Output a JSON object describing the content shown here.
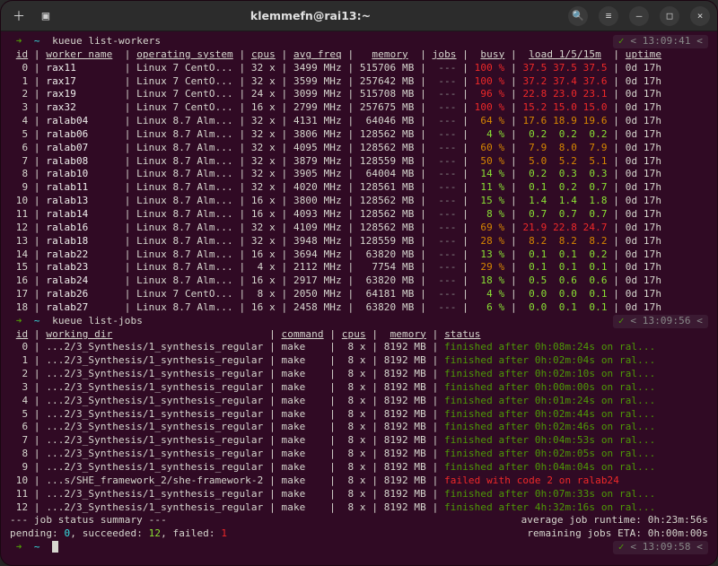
{
  "window": {
    "title": "klemmefn@rai13:~"
  },
  "prompt1": {
    "arrow": "➜",
    "path": "~",
    "cmd": "kueue list-workers",
    "time": "13:09:41",
    "check": "✓"
  },
  "headers_workers": {
    "id": "id",
    "name": "worker name",
    "os": "operating system",
    "cpus": "cpus",
    "freq": "avg freq",
    "mem": "memory",
    "jobs": "jobs",
    "busy": "busy",
    "load": "load 1/5/15m",
    "uptime": "uptime"
  },
  "workers": [
    {
      "id": "0",
      "name": "rax11",
      "os": "Linux 7 CentO...",
      "cpus": "32 x",
      "freq": "3499 MHz",
      "mem": "515706 MB",
      "jobs": "---",
      "busy": "100 %",
      "busyc": "red",
      "l1": "37.5",
      "l2": "37.5",
      "l3": "37.5",
      "lc": "red",
      "up": "0d 17h"
    },
    {
      "id": "1",
      "name": "rax17",
      "os": "Linux 7 CentO...",
      "cpus": "32 x",
      "freq": "3599 MHz",
      "mem": "257642 MB",
      "jobs": "---",
      "busy": "100 %",
      "busyc": "red",
      "l1": "37.2",
      "l2": "37.4",
      "l3": "37.6",
      "lc": "red",
      "up": "0d 17h"
    },
    {
      "id": "2",
      "name": "rax19",
      "os": "Linux 7 CentO...",
      "cpus": "24 x",
      "freq": "3099 MHz",
      "mem": "515708 MB",
      "jobs": "---",
      "busy": "96 %",
      "busyc": "red",
      "l1": "22.8",
      "l2": "23.0",
      "l3": "23.1",
      "lc": "red",
      "up": "0d 17h"
    },
    {
      "id": "3",
      "name": "rax32",
      "os": "Linux 7 CentO...",
      "cpus": "16 x",
      "freq": "2799 MHz",
      "mem": "257675 MB",
      "jobs": "---",
      "busy": "100 %",
      "busyc": "red",
      "l1": "15.2",
      "l2": "15.0",
      "l3": "15.0",
      "lc": "red",
      "up": "0d 17h"
    },
    {
      "id": "4",
      "name": "ralab04",
      "os": "Linux 8.7 Alm...",
      "cpus": "32 x",
      "freq": "4131 MHz",
      "mem": "64046 MB",
      "jobs": "---",
      "busy": "64 %",
      "busyc": "orange",
      "l1": "17.6",
      "l2": "18.9",
      "l3": "19.6",
      "lc": "orange",
      "up": "0d 17h"
    },
    {
      "id": "5",
      "name": "ralab06",
      "os": "Linux 8.7 Alm...",
      "cpus": "32 x",
      "freq": "3806 MHz",
      "mem": "128562 MB",
      "jobs": "---",
      "busy": "4 %",
      "busyc": "green",
      "l1": "0.2",
      "l2": "0.2",
      "l3": "0.2",
      "lc": "green",
      "up": "0d 17h"
    },
    {
      "id": "6",
      "name": "ralab07",
      "os": "Linux 8.7 Alm...",
      "cpus": "32 x",
      "freq": "4095 MHz",
      "mem": "128562 MB",
      "jobs": "---",
      "busy": "60 %",
      "busyc": "orange",
      "l1": "7.9",
      "l2": "8.0",
      "l3": "7.9",
      "lc": "orange",
      "up": "0d 17h"
    },
    {
      "id": "7",
      "name": "ralab08",
      "os": "Linux 8.7 Alm...",
      "cpus": "32 x",
      "freq": "3879 MHz",
      "mem": "128559 MB",
      "jobs": "---",
      "busy": "50 %",
      "busyc": "orange",
      "l1": "5.0",
      "l2": "5.2",
      "l3": "5.1",
      "lc": "orange",
      "up": "0d 17h"
    },
    {
      "id": "8",
      "name": "ralab10",
      "os": "Linux 8.7 Alm...",
      "cpus": "32 x",
      "freq": "3905 MHz",
      "mem": "64004 MB",
      "jobs": "---",
      "busy": "14 %",
      "busyc": "green",
      "l1": "0.2",
      "l2": "0.3",
      "l3": "0.3",
      "lc": "green",
      "up": "0d 17h"
    },
    {
      "id": "9",
      "name": "ralab11",
      "os": "Linux 8.7 Alm...",
      "cpus": "32 x",
      "freq": "4020 MHz",
      "mem": "128561 MB",
      "jobs": "---",
      "busy": "11 %",
      "busyc": "green",
      "l1": "0.1",
      "l2": "0.2",
      "l3": "0.7",
      "lc": "green",
      "up": "0d 17h"
    },
    {
      "id": "10",
      "name": "ralab13",
      "os": "Linux 8.7 Alm...",
      "cpus": "16 x",
      "freq": "3800 MHz",
      "mem": "128562 MB",
      "jobs": "---",
      "busy": "15 %",
      "busyc": "green",
      "l1": "1.4",
      "l2": "1.4",
      "l3": "1.8",
      "lc": "green",
      "up": "0d 17h"
    },
    {
      "id": "11",
      "name": "ralab14",
      "os": "Linux 8.7 Alm...",
      "cpus": "16 x",
      "freq": "4093 MHz",
      "mem": "128562 MB",
      "jobs": "---",
      "busy": "8 %",
      "busyc": "green",
      "l1": "0.7",
      "l2": "0.7",
      "l3": "0.7",
      "lc": "green",
      "up": "0d 17h"
    },
    {
      "id": "12",
      "name": "ralab16",
      "os": "Linux 8.7 Alm...",
      "cpus": "32 x",
      "freq": "4109 MHz",
      "mem": "128562 MB",
      "jobs": "---",
      "busy": "69 %",
      "busyc": "orange",
      "l1": "21.9",
      "l2": "22.8",
      "l3": "24.7",
      "lc": "red",
      "up": "0d 17h"
    },
    {
      "id": "13",
      "name": "ralab18",
      "os": "Linux 8.7 Alm...",
      "cpus": "32 x",
      "freq": "3948 MHz",
      "mem": "128559 MB",
      "jobs": "---",
      "busy": "28 %",
      "busyc": "orange",
      "l1": "8.2",
      "l2": "8.2",
      "l3": "8.2",
      "lc": "orange",
      "up": "0d 17h"
    },
    {
      "id": "14",
      "name": "ralab22",
      "os": "Linux 8.7 Alm...",
      "cpus": "16 x",
      "freq": "3694 MHz",
      "mem": "63820 MB",
      "jobs": "---",
      "busy": "13 %",
      "busyc": "green",
      "l1": "0.1",
      "l2": "0.1",
      "l3": "0.2",
      "lc": "green",
      "up": "0d 17h"
    },
    {
      "id": "15",
      "name": "ralab23",
      "os": "Linux 8.7 Alm...",
      "cpus": "4 x",
      "freq": "2112 MHz",
      "mem": "7754 MB",
      "jobs": "---",
      "busy": "29 %",
      "busyc": "orange",
      "l1": "0.1",
      "l2": "0.1",
      "l3": "0.1",
      "lc": "green",
      "up": "0d 17h"
    },
    {
      "id": "16",
      "name": "ralab24",
      "os": "Linux 8.7 Alm...",
      "cpus": "16 x",
      "freq": "2917 MHz",
      "mem": "63820 MB",
      "jobs": "---",
      "busy": "18 %",
      "busyc": "green",
      "l1": "0.5",
      "l2": "0.6",
      "l3": "0.6",
      "lc": "green",
      "up": "0d 17h"
    },
    {
      "id": "17",
      "name": "ralab26",
      "os": "Linux 7 CentO...",
      "cpus": "8 x",
      "freq": "2050 MHz",
      "mem": "64181 MB",
      "jobs": "---",
      "busy": "4 %",
      "busyc": "green",
      "l1": "0.0",
      "l2": "0.0",
      "l3": "0.1",
      "lc": "green",
      "up": "0d 17h"
    },
    {
      "id": "18",
      "name": "ralab27",
      "os": "Linux 8.7 Alm...",
      "cpus": "16 x",
      "freq": "2458 MHz",
      "mem": "63820 MB",
      "jobs": "---",
      "busy": "6 %",
      "busyc": "green",
      "l1": "0.0",
      "l2": "0.1",
      "l3": "0.1",
      "lc": "green",
      "up": "0d 17h"
    }
  ],
  "prompt2": {
    "arrow": "➜",
    "path": "~",
    "cmd": "kueue list-jobs",
    "time": "13:09:56",
    "check": "✓"
  },
  "headers_jobs": {
    "id": "id",
    "wd": "working dir",
    "cmd": "command",
    "cpus": "cpus",
    "mem": "memory",
    "status": "status"
  },
  "jobs": [
    {
      "id": "0",
      "wd": "...2/3_Synthesis/1_synthesis_regular",
      "cmd": "make",
      "cpus": "8 x",
      "mem": "8192 MB",
      "status": "finished after 0h:08m:24s on ral...",
      "sc": "statusok"
    },
    {
      "id": "1",
      "wd": "...2/3_Synthesis/1_synthesis_regular",
      "cmd": "make",
      "cpus": "8 x",
      "mem": "8192 MB",
      "status": "finished after 0h:02m:04s on ral...",
      "sc": "statusok"
    },
    {
      "id": "2",
      "wd": "...2/3_Synthesis/1_synthesis_regular",
      "cmd": "make",
      "cpus": "8 x",
      "mem": "8192 MB",
      "status": "finished after 0h:02m:10s on ral...",
      "sc": "statusok"
    },
    {
      "id": "3",
      "wd": "...2/3_Synthesis/1_synthesis_regular",
      "cmd": "make",
      "cpus": "8 x",
      "mem": "8192 MB",
      "status": "finished after 0h:00m:00s on ral...",
      "sc": "statusok"
    },
    {
      "id": "4",
      "wd": "...2/3_Synthesis/1_synthesis_regular",
      "cmd": "make",
      "cpus": "8 x",
      "mem": "8192 MB",
      "status": "finished after 0h:01m:24s on ral...",
      "sc": "statusok"
    },
    {
      "id": "5",
      "wd": "...2/3_Synthesis/1_synthesis_regular",
      "cmd": "make",
      "cpus": "8 x",
      "mem": "8192 MB",
      "status": "finished after 0h:02m:44s on ral...",
      "sc": "statusok"
    },
    {
      "id": "6",
      "wd": "...2/3_Synthesis/1_synthesis_regular",
      "cmd": "make",
      "cpus": "8 x",
      "mem": "8192 MB",
      "status": "finished after 0h:02m:46s on ral...",
      "sc": "statusok"
    },
    {
      "id": "7",
      "wd": "...2/3_Synthesis/1_synthesis_regular",
      "cmd": "make",
      "cpus": "8 x",
      "mem": "8192 MB",
      "status": "finished after 0h:04m:53s on ral...",
      "sc": "statusok"
    },
    {
      "id": "8",
      "wd": "...2/3_Synthesis/1_synthesis_regular",
      "cmd": "make",
      "cpus": "8 x",
      "mem": "8192 MB",
      "status": "finished after 0h:02m:05s on ral...",
      "sc": "statusok"
    },
    {
      "id": "9",
      "wd": "...2/3_Synthesis/1_synthesis_regular",
      "cmd": "make",
      "cpus": "8 x",
      "mem": "8192 MB",
      "status": "finished after 0h:04m:04s on ral...",
      "sc": "statusok"
    },
    {
      "id": "10",
      "wd": "...s/SHE_framework_2/she-framework-2",
      "cmd": "make",
      "cpus": "8 x",
      "mem": "8192 MB",
      "status": "failed with code 2 on ralab24",
      "sc": "statusfail"
    },
    {
      "id": "11",
      "wd": "...2/3_Synthesis/1_synthesis_regular",
      "cmd": "make",
      "cpus": "8 x",
      "mem": "8192 MB",
      "status": "finished after 0h:07m:33s on ral...",
      "sc": "statusok"
    },
    {
      "id": "12",
      "wd": "...2/3_Synthesis/1_synthesis_regular",
      "cmd": "make",
      "cpus": "8 x",
      "mem": "8192 MB",
      "status": "finished after 4h:32m:16s on ral...",
      "sc": "statusok"
    }
  ],
  "summary": {
    "title": "--- job status summary ---",
    "pending_label": "pending: ",
    "pending": "0",
    "succeeded_label": ", succeeded: ",
    "succeeded": "12",
    "failed_label": ", failed: ",
    "failed": "1",
    "avg_label": "average job runtime: ",
    "avg": "0h:23m:56s",
    "eta_label": "remaining jobs ETA: ",
    "eta": "0h:00m:00s"
  },
  "prompt3": {
    "arrow": "➜",
    "path": "~",
    "time": "13:09:58",
    "check": "✓"
  }
}
